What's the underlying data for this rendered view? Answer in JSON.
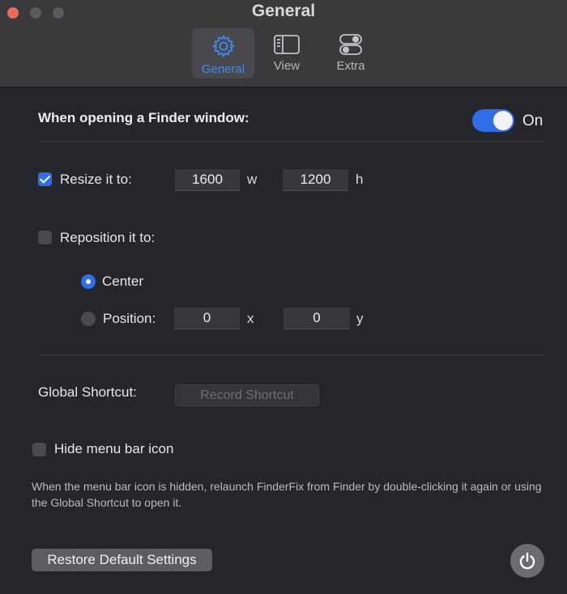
{
  "window": {
    "title": "General",
    "tabs": [
      {
        "label": "General",
        "icon": "gear-icon",
        "active": true
      },
      {
        "label": "View",
        "icon": "sidebar-window-icon",
        "active": false
      },
      {
        "label": "Extra",
        "icon": "toggles-icon",
        "active": false
      }
    ]
  },
  "finder": {
    "heading": "When opening a Finder window:",
    "toggle_label": "On",
    "toggle_on": true
  },
  "resize": {
    "label": "Resize it to:",
    "checked": true,
    "width": "1600",
    "width_unit": "w",
    "height": "1200",
    "height_unit": "h"
  },
  "reposition": {
    "label": "Reposition it to:",
    "checked": false,
    "center_label": "Center",
    "position_label": "Position:",
    "x": "0",
    "x_unit": "x",
    "y": "0",
    "y_unit": "y"
  },
  "shortcut": {
    "label": "Global Shortcut:",
    "button": "Record Shortcut"
  },
  "menubar": {
    "label": "Hide menu bar icon",
    "checked": false,
    "help": "When the menu bar icon is hidden, relaunch FinderFix from Finder by double-clicking it again or using the Global Shortcut to open it."
  },
  "footer": {
    "restore_button": "Restore Default Settings",
    "power_icon": "power-icon"
  },
  "colors": {
    "accent": "#2f6ee6",
    "active_tab_text": "#3d8cf5",
    "background": "#25262b",
    "titlebar": "#3a3a3d"
  }
}
